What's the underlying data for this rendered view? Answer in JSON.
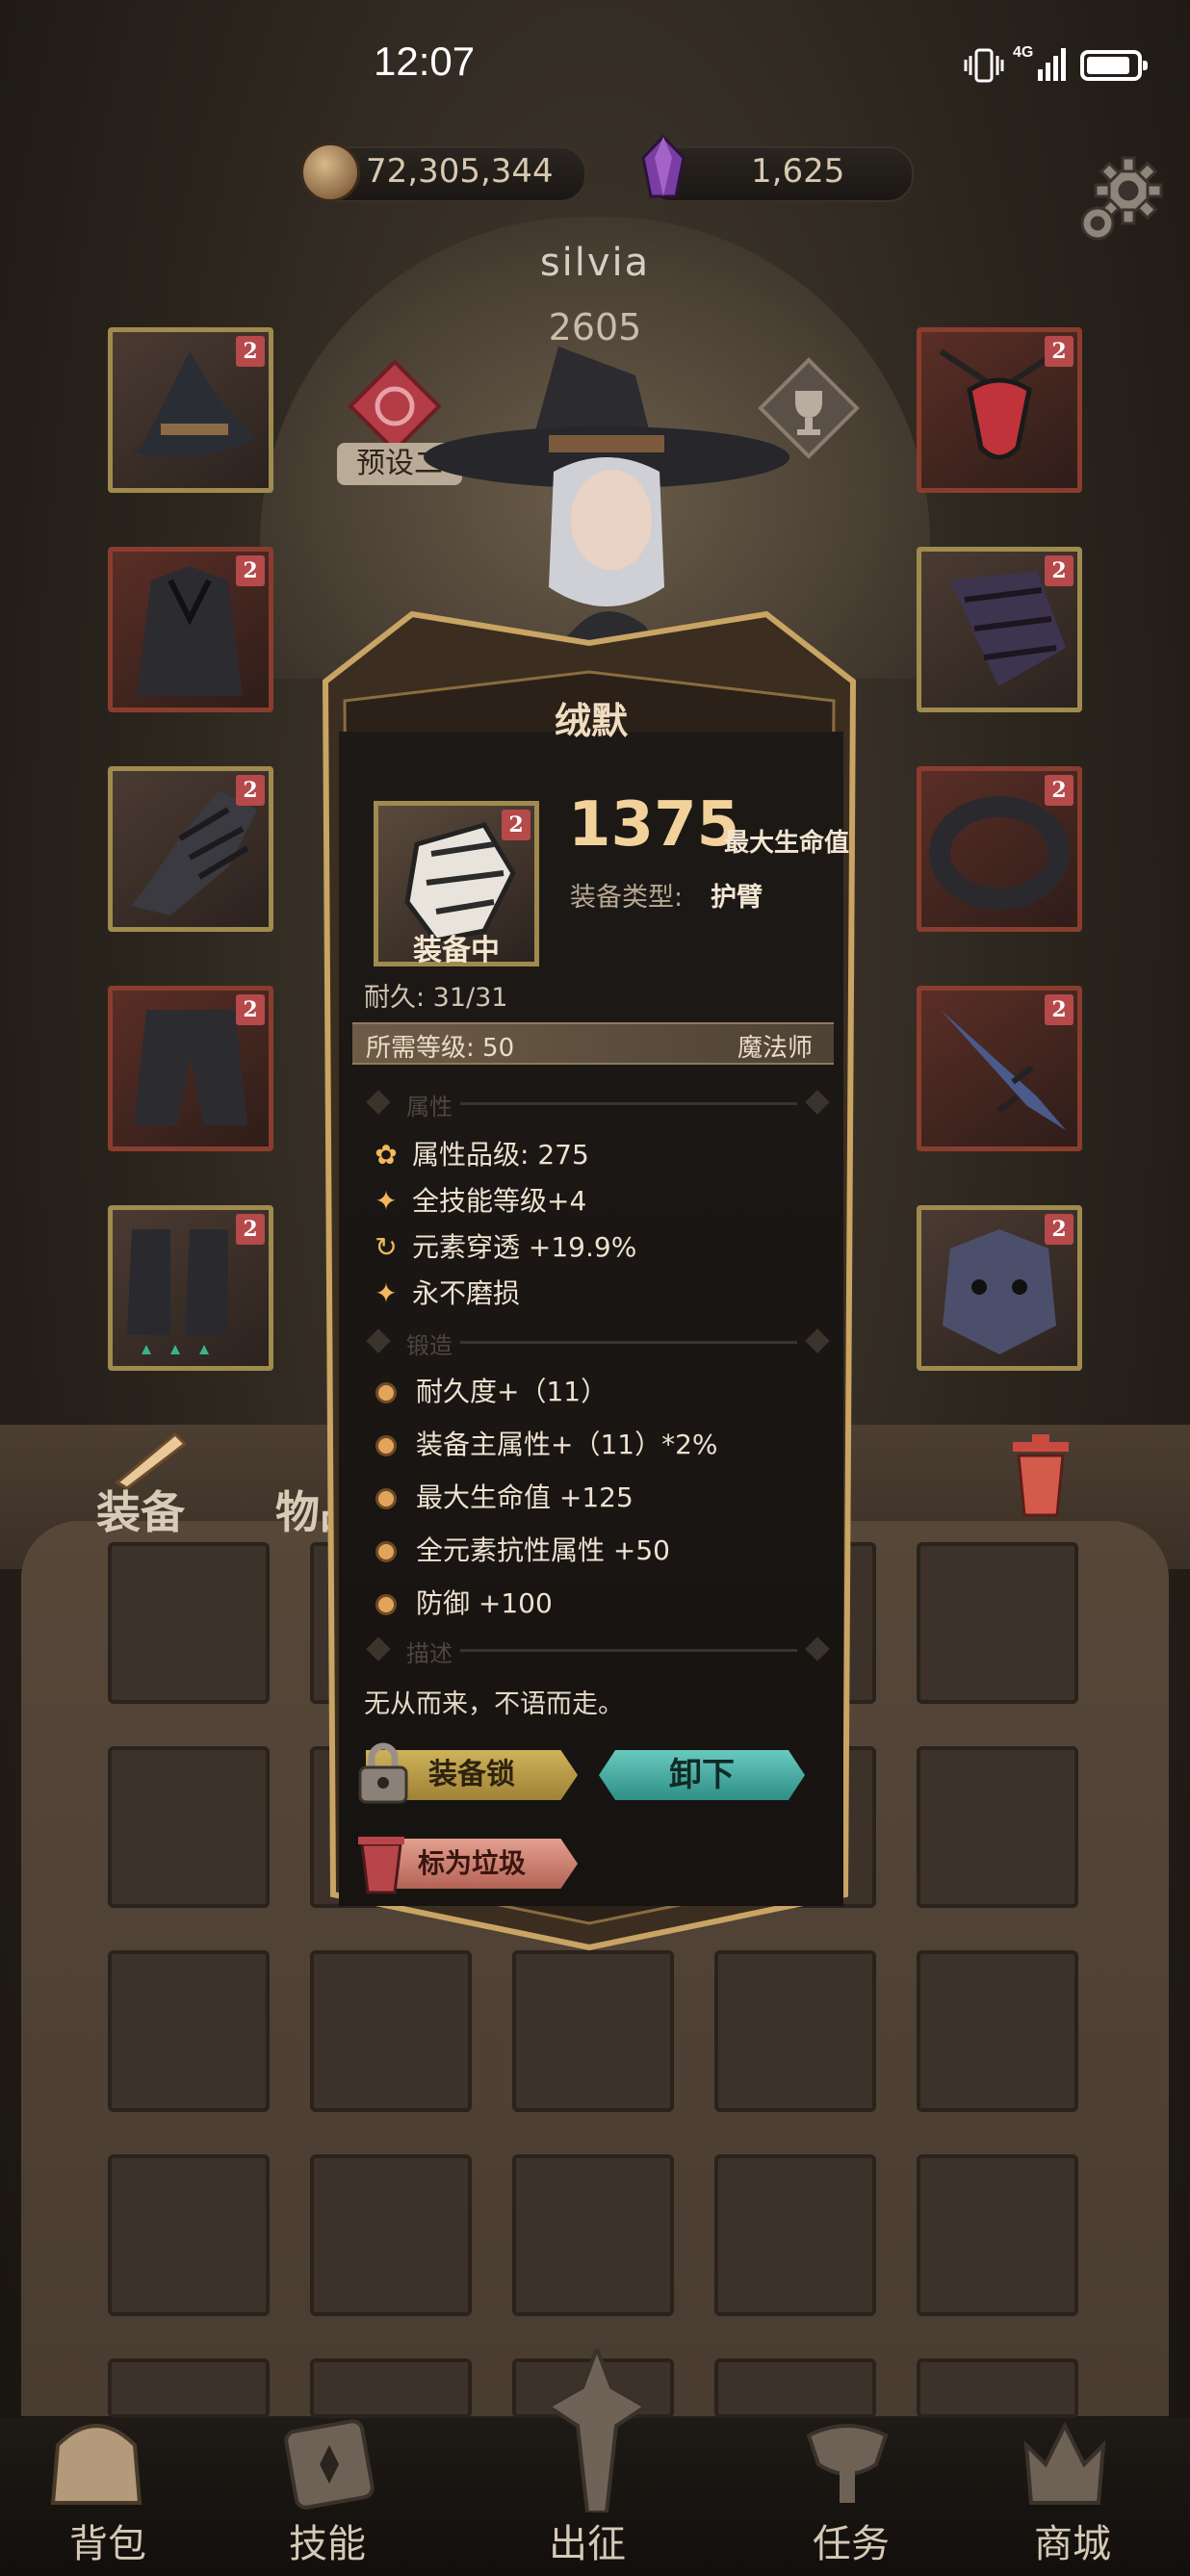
{
  "status_bar": {
    "time": "12:07",
    "network": "4G"
  },
  "currency": {
    "gold": "72,305,344",
    "gems": "1,625"
  },
  "character": {
    "name": "silvia",
    "power": "2605",
    "preset": "预设二"
  },
  "equip_slots": [
    {
      "name": "hat",
      "tier": "2",
      "frame": "gold"
    },
    {
      "name": "armor",
      "tier": "2",
      "frame": "red"
    },
    {
      "name": "gloves",
      "tier": "2",
      "frame": "gold"
    },
    {
      "name": "pants",
      "tier": "2",
      "frame": "red"
    },
    {
      "name": "boots",
      "tier": "2",
      "frame": "gold"
    },
    {
      "name": "amulet",
      "tier": "2",
      "frame": "red"
    },
    {
      "name": "bracer",
      "tier": "2",
      "frame": "gold"
    },
    {
      "name": "ring",
      "tier": "2",
      "frame": "red"
    },
    {
      "name": "weapon",
      "tier": "2",
      "frame": "red"
    },
    {
      "name": "offhand",
      "tier": "2",
      "frame": "gold"
    }
  ],
  "item": {
    "title": "绒默",
    "tier": "2",
    "equipped_label": "装备中",
    "main_value": "1375",
    "main_stat": "最大生命值",
    "type_label": "装备类型:",
    "type_value": "护臂",
    "durability": "耐久: 31/31",
    "req_level": "所需等级: 50",
    "req_class": "魔法师",
    "sections": {
      "attributes": "属性",
      "forging": "锻造",
      "description": "描述"
    },
    "attributes": [
      {
        "icon": "quality-icon",
        "text": "属性品级: 275"
      },
      {
        "icon": "star-icon",
        "text": "全技能等级+4"
      },
      {
        "icon": "cycle-icon",
        "text": "元素穿透 +19.9%"
      },
      {
        "icon": "star-icon",
        "text": "永不磨损"
      }
    ],
    "forging": [
      "耐久度+（11）",
      "装备主属性+（11）*2%",
      "最大生命值 +125",
      "全元素抗性属性 +50",
      "防御 +100"
    ],
    "description": "无从而来，不语而走。",
    "buttons": {
      "lock": "装备锁",
      "unequip": "卸下",
      "mark_trash": "标为垃圾"
    }
  },
  "inventory": {
    "tabs": [
      "装备",
      "物品"
    ]
  },
  "nav": [
    "背包",
    "技能",
    "出征",
    "任务",
    "商城"
  ],
  "colors": {
    "gold_text": "#f2d29a",
    "accent_teal": "#2f8f86",
    "tier_badge": "#b6494a"
  }
}
